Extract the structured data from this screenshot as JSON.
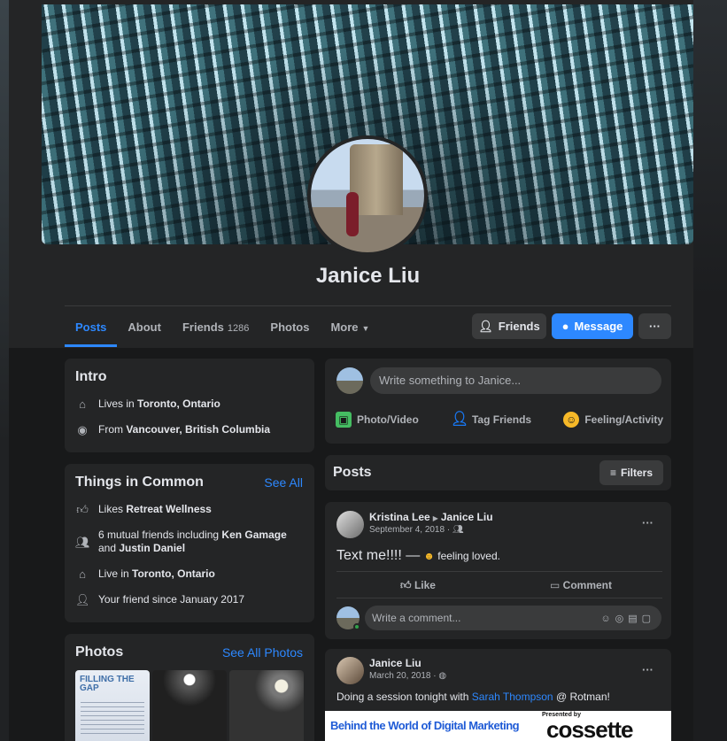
{
  "profile": {
    "name": "Janice Liu"
  },
  "tabs": [
    {
      "label": "Posts",
      "count": ""
    },
    {
      "label": "About",
      "count": ""
    },
    {
      "label": "Friends",
      "count": "1286"
    },
    {
      "label": "Photos",
      "count": ""
    },
    {
      "label": "More",
      "count": ""
    }
  ],
  "actions": {
    "friends": "Friends",
    "message": "Message",
    "more": "···"
  },
  "intro": {
    "title": "Intro",
    "lives_prefix": "Lives in",
    "lives_place": "Toronto, Ontario",
    "from_prefix": "From",
    "from_place": "Vancouver, British Columbia"
  },
  "common": {
    "title": "Things in Common",
    "see_all": "See All",
    "likes_prefix": "Likes",
    "likes_page": "Retreat Wellness",
    "mutual_prefix": "6 mutual friends including",
    "mutual_a": "Ken Gamage",
    "mutual_and": "and",
    "mutual_b": "Justin Daniel",
    "live_prefix": "Live in",
    "live_place": "Toronto, Ontario",
    "since": "Your friend since January 2017"
  },
  "photos": {
    "title": "Photos",
    "see_all": "See All Photos",
    "thumb1_text": "FILLING THE GAP"
  },
  "composer": {
    "placeholder": "Write something to Janice...",
    "photo": "Photo/Video",
    "tag": "Tag Friends",
    "feeling": "Feeling/Activity"
  },
  "posts_header": {
    "title": "Posts",
    "filters": "Filters"
  },
  "post1": {
    "author": "Kristina Lee",
    "target": "Janice Liu",
    "date": "September 4, 2018 ·",
    "text": "Text me!!!! —",
    "feeling": "feeling loved.",
    "like": "Like",
    "comment": "Comment",
    "comment_placeholder": "Write a comment..."
  },
  "post2": {
    "author": "Janice Liu",
    "date": "March 20, 2018 ·",
    "text_before": "Doing a session tonight with",
    "text_link": "Sarah Thompson",
    "text_after": "@ Rotman!",
    "banner_title": "Behind the World of Digital Marketing",
    "banner_presented": "Presented by",
    "banner_brand": "cossette"
  },
  "colors": {
    "accent": "#2d88ff",
    "card": "#242526",
    "page_bg": "#18191a"
  }
}
